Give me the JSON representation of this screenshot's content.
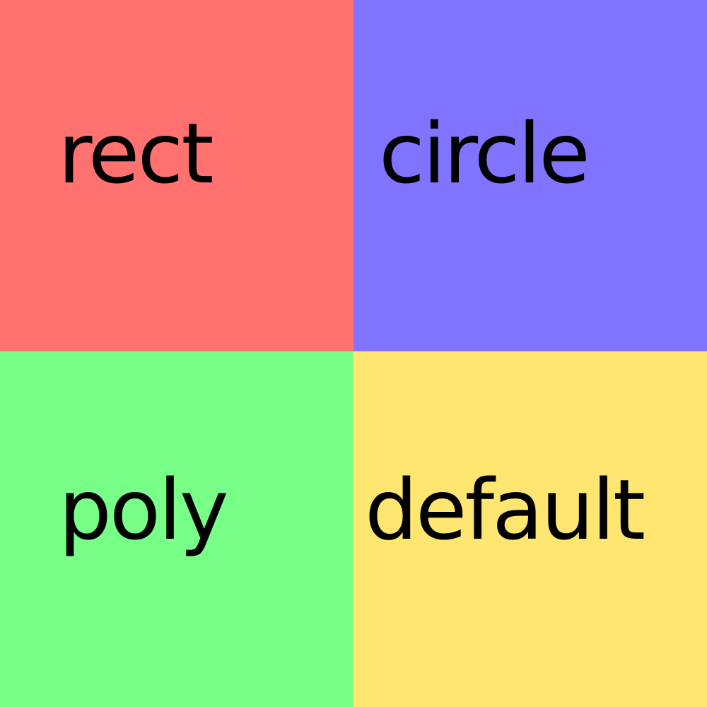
{
  "tiles": [
    {
      "label": "rect",
      "color": "#ff7270"
    },
    {
      "label": "circle",
      "color": "#8074ff"
    },
    {
      "label": "poly",
      "color": "#78ff88"
    },
    {
      "label": "default",
      "color": "#ffe671"
    }
  ]
}
